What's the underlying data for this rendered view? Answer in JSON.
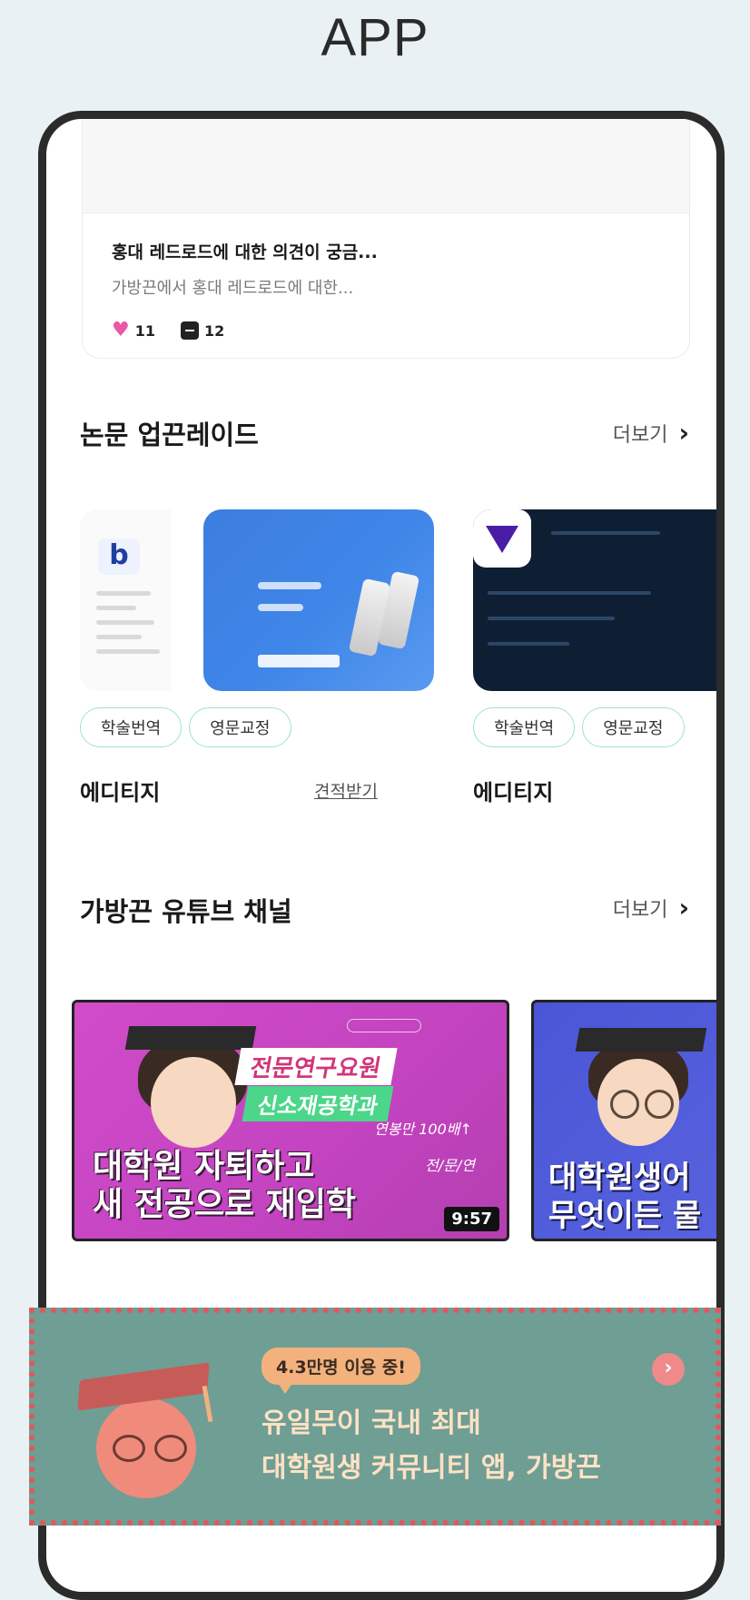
{
  "page_label": "APP",
  "post": {
    "title": "홍대 레드로드에 대한 의견이 궁금...",
    "excerpt": "가방끈에서 홍대 레드로드에 대한...",
    "likes": "11",
    "comments": "12"
  },
  "papers": {
    "title": "논문 업끈레이드",
    "more_label": "더보기",
    "cards": [
      {
        "tags": [
          "학술번역",
          "영문교정"
        ],
        "name": "에디티지",
        "quote_label": "견적받기"
      },
      {
        "tags": [
          "학술번역",
          "영문교정"
        ],
        "name": "에디티지"
      }
    ]
  },
  "youtube": {
    "title": "가방끈 유튜브 채널",
    "more_label": "더보기",
    "videos": [
      {
        "badge1": "전문연구요원",
        "badge2": "신소재공학과",
        "handwriting1": "연봉만 100배↑",
        "handwriting2": "전/문/연",
        "title_line1": "대학원 자퇴하고",
        "title_line2": "새 전공으로 재입학",
        "duration": "9:57"
      },
      {
        "title_line1": "대학원생어",
        "title_line2": "무엇이든 물"
      }
    ]
  },
  "banner": {
    "badge": "4.3만명 이용 중!",
    "line1": "유일무이 국내 최대",
    "line2": "대학원생 커뮤니티 앱, 가방끈",
    "highlight_color": "#e8545c",
    "background_color": "#6f9e94"
  }
}
